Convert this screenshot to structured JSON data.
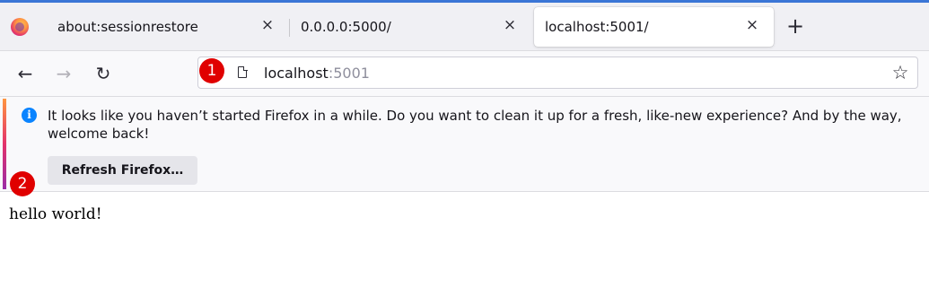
{
  "tabs": [
    {
      "title": "about:sessionrestore",
      "close": "×"
    },
    {
      "title": "0.0.0.0:5000/",
      "close": "×"
    },
    {
      "title": "localhost:5001/",
      "close": "×",
      "selected": true
    }
  ],
  "new_tab_label": "+",
  "nav": {
    "back": "←",
    "forward": "→",
    "reload": "↻"
  },
  "url": {
    "host": "localhost",
    "port": ":5001"
  },
  "bookmark_star": "☆",
  "notification": {
    "info_glyph": "i",
    "message": "It looks like you haven’t started Firefox in a while. Do you want to clean it up for a fresh, like-new experience? And by the way, welcome back!",
    "button_label": "Refresh Firefox…"
  },
  "page": {
    "text": "hello world!"
  },
  "markers": [
    "1",
    "2"
  ],
  "colors": {
    "accent": "#3b76d6",
    "marker": "#e00000",
    "info": "#0a84ff"
  }
}
